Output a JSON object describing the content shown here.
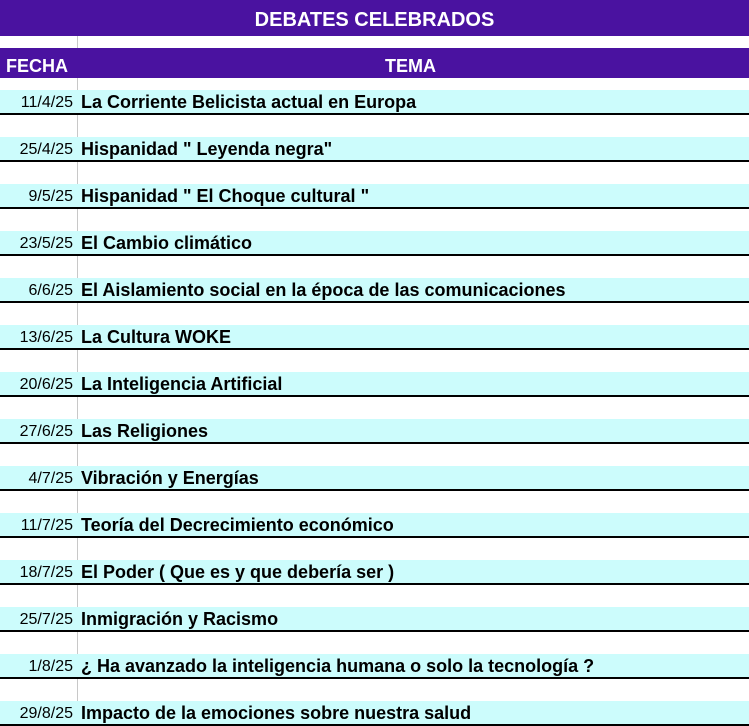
{
  "title": "DEBATES CELEBRADOS",
  "headers": {
    "fecha": "FECHA",
    "tema": "TEMA"
  },
  "colors": {
    "header_bg": "#4a12a0",
    "row_bg": "#ccfcfc"
  },
  "rows": [
    {
      "fecha": "11/4/25",
      "tema": "La Corriente Belicista actual en Europa"
    },
    {
      "fecha": "25/4/25",
      "tema": "Hispanidad \" Leyenda negra\""
    },
    {
      "fecha": "9/5/25",
      "tema": "Hispanidad \" El Choque cultural \""
    },
    {
      "fecha": "23/5/25",
      "tema": "El Cambio climático"
    },
    {
      "fecha": "6/6/25",
      "tema": "El Aislamiento social en la época de las comunicaciones"
    },
    {
      "fecha": "13/6/25",
      "tema": "La Cultura WOKE"
    },
    {
      "fecha": "20/6/25",
      "tema": "La Inteligencia Artificial"
    },
    {
      "fecha": "27/6/25",
      "tema": "Las Religiones"
    },
    {
      "fecha": "4/7/25",
      "tema": "Vibración y Energías"
    },
    {
      "fecha": "11/7/25",
      "tema": "Teoría del Decrecimiento económico"
    },
    {
      "fecha": "18/7/25",
      "tema": "El Poder  ( Que es y que debería ser )"
    },
    {
      "fecha": "25/7/25",
      "tema": "Inmigración y Racismo"
    },
    {
      "fecha": "1/8/25",
      "tema": "¿ Ha avanzado la inteligencia humana o solo la tecnología ?"
    },
    {
      "fecha": "29/8/25",
      "tema": "Impacto de la emociones sobre nuestra salud"
    }
  ]
}
